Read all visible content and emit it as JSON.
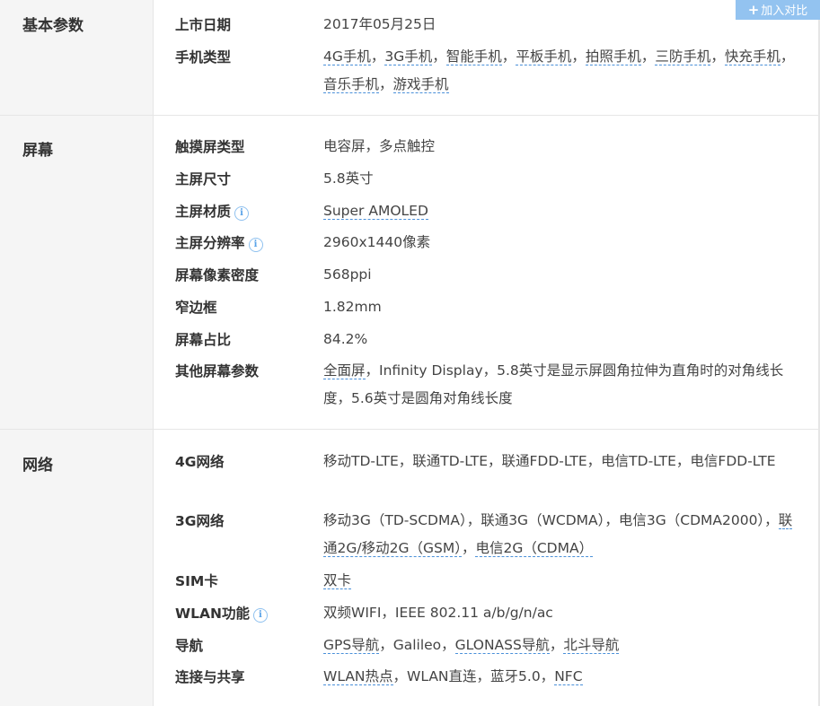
{
  "compare_button": {
    "icon": "+",
    "label": "加入对比"
  },
  "sections": [
    {
      "title": "基本参数",
      "rows": [
        {
          "label": "上市日期",
          "value": [
            {
              "t": "2017年05月25日"
            }
          ]
        },
        {
          "label": "手机类型",
          "value": [
            {
              "t": "4G手机",
              "link": true
            },
            {
              "t": "，",
              "sep": true
            },
            {
              "t": "3G手机",
              "link": true
            },
            {
              "t": "，",
              "sep": true
            },
            {
              "t": "智能手机",
              "link": true
            },
            {
              "t": "，",
              "sep": true
            },
            {
              "t": "平板手机",
              "link": true
            },
            {
              "t": "，",
              "sep": true
            },
            {
              "t": "拍照手机",
              "link": true
            },
            {
              "t": "，",
              "sep": true
            },
            {
              "t": "三防手机",
              "link": true
            },
            {
              "t": "，",
              "sep": true
            },
            {
              "t": "快充手机",
              "link": true
            },
            {
              "t": "，",
              "sep": true
            },
            {
              "t": "音乐手机",
              "link": true
            },
            {
              "t": "，",
              "sep": true
            },
            {
              "t": "游戏手机",
              "link": true
            }
          ]
        }
      ]
    },
    {
      "title": "屏幕",
      "rows": [
        {
          "label": "触摸屏类型",
          "value": [
            {
              "t": "电容屏，多点触控"
            }
          ]
        },
        {
          "label": "主屏尺寸",
          "value": [
            {
              "t": "5.8英寸"
            }
          ]
        },
        {
          "label": "主屏材质",
          "info": "i",
          "value": [
            {
              "t": "Super AMOLED",
              "link": true
            }
          ]
        },
        {
          "label": "主屏分辨率",
          "info": "i",
          "value": [
            {
              "t": "2960x1440像素"
            }
          ]
        },
        {
          "label": "屏幕像素密度",
          "value": [
            {
              "t": "568ppi"
            }
          ]
        },
        {
          "label": "窄边框",
          "value": [
            {
              "t": "1.82mm"
            }
          ]
        },
        {
          "label": "屏幕占比",
          "value": [
            {
              "t": "84.2%"
            }
          ]
        },
        {
          "label": "其他屏幕参数",
          "value": [
            {
              "t": "全面屏",
              "link": true
            },
            {
              "t": "，Infinity Display，5.8英寸是显示屏圆角拉伸为直角时的对角线长度，5.6英寸是圆角对角线长度"
            }
          ]
        }
      ]
    },
    {
      "title": "网络",
      "rows": [
        {
          "label": "4G网络",
          "value": [
            {
              "t": "移动TD-LTE，联通TD-LTE，联通FDD-LTE，电信TD-LTE，电信FDD-LTE"
            }
          ]
        },
        {
          "label": "3G网络",
          "value": [
            {
              "t": "移动3G（TD-SCDMA），联通3G（WCDMA），电信3G（CDMA2000），"
            },
            {
              "t": "联通2G/移动2G（GSM）",
              "link": true
            },
            {
              "t": "，",
              "sep": true
            },
            {
              "t": "电信2G（CDMA）",
              "link": true
            }
          ]
        },
        {
          "label": "SIM卡",
          "value": [
            {
              "t": "双卡",
              "link": true
            }
          ]
        },
        {
          "label": "WLAN功能",
          "info": "i",
          "value": [
            {
              "t": "双频WIFI，IEEE 802.11 a/b/g/n/ac"
            }
          ]
        },
        {
          "label": "导航",
          "value": [
            {
              "t": "GPS导航",
              "link": true
            },
            {
              "t": "，Galileo，"
            },
            {
              "t": "GLONASS导航",
              "link": true
            },
            {
              "t": "，",
              "sep": true
            },
            {
              "t": "北斗导航",
              "link": true
            }
          ]
        },
        {
          "label": "连接与共享",
          "value": [
            {
              "t": "WLAN热点",
              "link": true
            },
            {
              "t": "，WLAN直连，蓝牙5.0，"
            },
            {
              "t": "NFC",
              "link": true
            }
          ]
        }
      ]
    }
  ]
}
